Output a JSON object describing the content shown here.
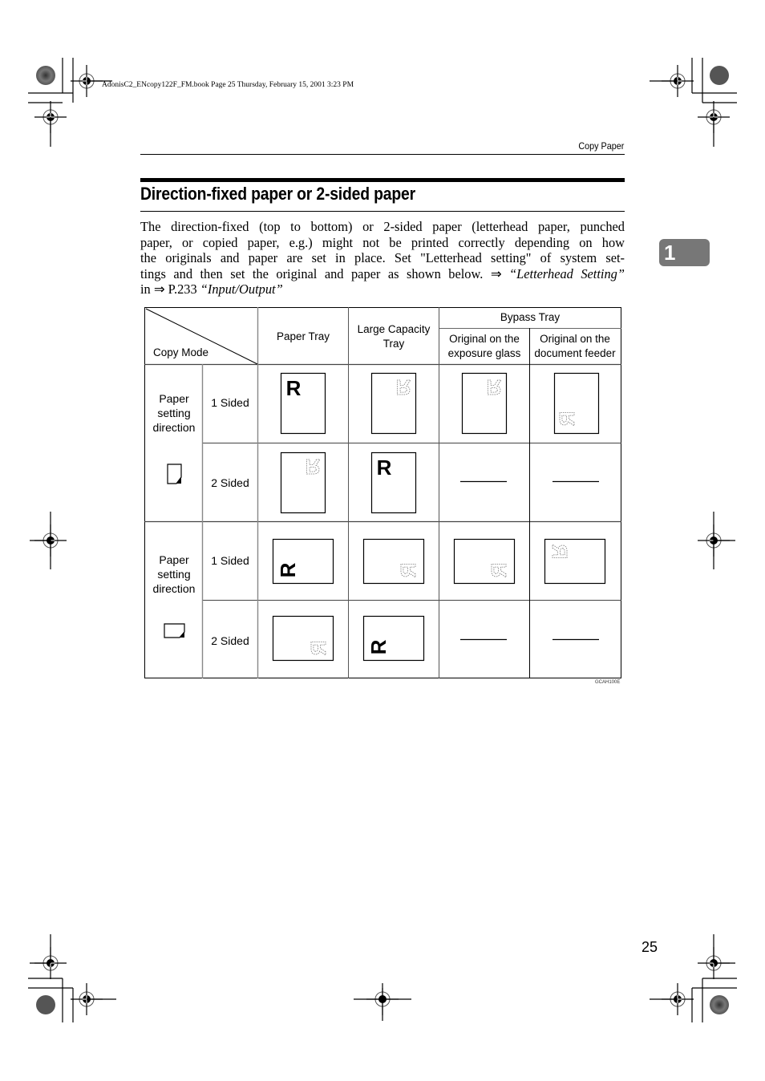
{
  "print_info": "AdonisC2_ENcopy122F_FM.book  Page 25  Thursday, February 15, 2001  3:23 PM",
  "running_head": "Copy Paper",
  "section_title": "Direction-fixed paper or 2-sided paper",
  "chapter_tab": "1",
  "body_lines": [
    "The direction-fixed (top to bottom) or 2-sided paper (letterhead paper, punched",
    "paper, or copied paper, e.g.) might not be printed correctly depending on how",
    "the originals and paper are set in place. Set \"Letterhead setting\" of system set-",
    "tings and then set the original and paper as shown below. ⇒ "
  ],
  "body_ref1": "“Letterhead Setting”",
  "body_line5_prefix": "in ⇒ P.233 ",
  "body_ref2": "“Input/Output”",
  "table": {
    "corner_label": "Copy Mode",
    "columns": {
      "paper_tray": "Paper Tray",
      "lct_line1": "Large Capacity",
      "lct_line2": "Tray",
      "bypass": "Bypass Tray",
      "glass_line1": "Original on the",
      "glass_line2": "exposure glass",
      "feeder_line1": "Original on the",
      "feeder_line2": "document feeder"
    },
    "groups": [
      {
        "label_lines": [
          "Paper",
          "setting",
          "direction"
        ],
        "orientation": "portrait",
        "rows": [
          {
            "mode": "1 Sided",
            "cells": [
              "R-solid-topleft",
              "R-dotted-mirrored-topright",
              "R-dotted-mirrored-topright",
              "R-dotted-rotated-bottomleft"
            ]
          },
          {
            "mode": "2 Sided",
            "cells": [
              "R-dotted-mirrored-topright",
              "R-solid-topleft",
              "none",
              "none"
            ]
          }
        ]
      },
      {
        "label_lines": [
          "Paper",
          "setting",
          "direction"
        ],
        "orientation": "landscape",
        "rows": [
          {
            "mode": "1 Sided",
            "cells": [
              "R-solid-rotated-bottomleft",
              "R-dotted-rotated-bottomright",
              "R-dotted-rotated-bottomright",
              "R-dotted-rotated-topleft"
            ]
          },
          {
            "mode": "2 Sided",
            "cells": [
              "R-dotted-rotated-bottomright",
              "R-solid-rotated-bottomleft",
              "none",
              "none"
            ]
          }
        ]
      }
    ],
    "figure_code": "GCAH100E",
    "letter": "R"
  },
  "page_number": "25"
}
